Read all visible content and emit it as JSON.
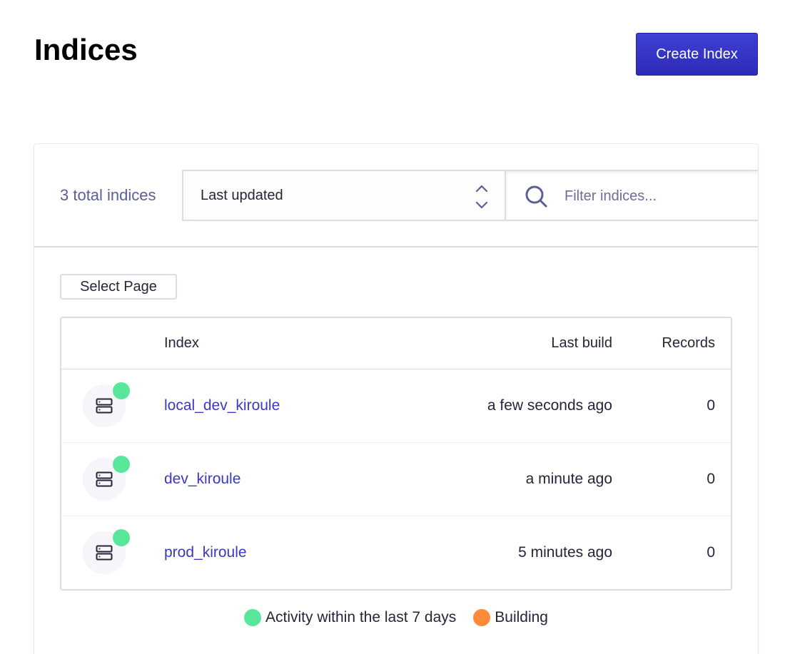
{
  "header": {
    "title": "Indices",
    "create_label": "Create Index"
  },
  "toolbar": {
    "total": "3 total indices",
    "sort_value": "Last updated",
    "search_placeholder": "Filter indices..."
  },
  "select_page_label": "Select Page",
  "table": {
    "columns": {
      "index": "Index",
      "last_build": "Last build",
      "records": "Records"
    },
    "rows": [
      {
        "name": "local_dev_kiroule",
        "last_build": "a few seconds ago",
        "records": "0",
        "status": "active"
      },
      {
        "name": "dev_kiroule",
        "last_build": "a minute ago",
        "records": "0",
        "status": "active"
      },
      {
        "name": "prod_kiroule",
        "last_build": "5 minutes ago",
        "records": "0",
        "status": "active"
      }
    ]
  },
  "legend": {
    "active_label": "Activity within the last 7 days",
    "building_label": "Building"
  },
  "colors": {
    "accent": "#3a38c4",
    "active": "#58e69a",
    "building": "#ff8a3a"
  }
}
